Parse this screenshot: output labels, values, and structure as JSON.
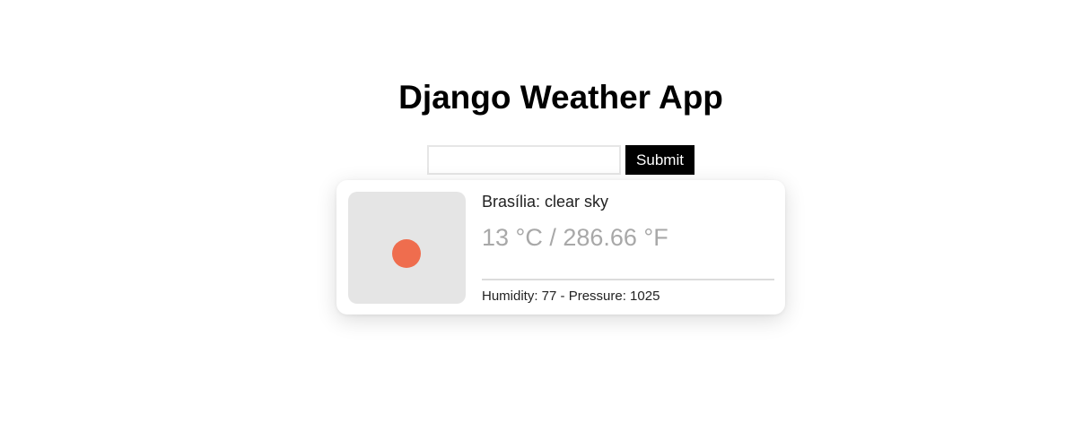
{
  "page": {
    "title": "Django Weather App"
  },
  "search": {
    "value": "",
    "placeholder": "",
    "submit_label": "Submit"
  },
  "weather": {
    "city": "Brasília",
    "description": "clear sky",
    "header": "Brasília: clear sky",
    "temperature_text": "13 °C / 286.66 °F",
    "details_text": "Humidity: 77 - Pressure: 1025",
    "icon": "sun-icon",
    "icon_color": "#ef6d4e"
  }
}
